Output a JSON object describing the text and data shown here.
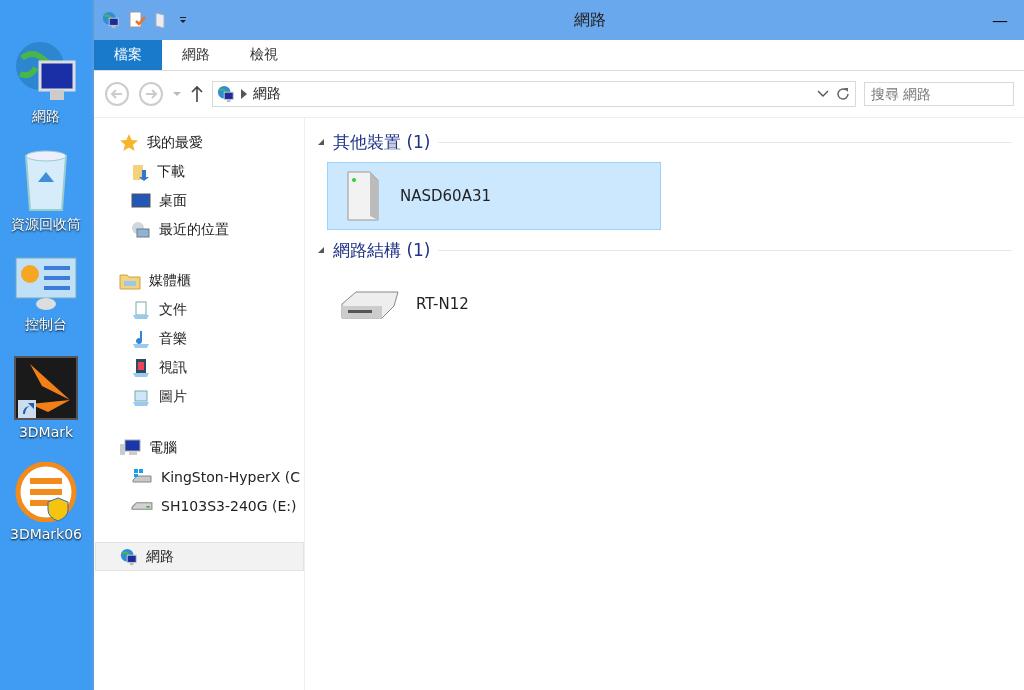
{
  "desktop_icons": [
    {
      "label": "網路",
      "kind": "network"
    },
    {
      "label": "資源回收筒",
      "kind": "recycle"
    },
    {
      "label": "控制台",
      "kind": "control"
    },
    {
      "label": "3DMark",
      "kind": "mark"
    },
    {
      "label": "3DMark06",
      "kind": "mark06"
    }
  ],
  "window": {
    "title": "網路",
    "minimize": "—"
  },
  "ribbon_tabs": [
    {
      "label": "檔案",
      "selected": true
    },
    {
      "label": "網路",
      "selected": false
    },
    {
      "label": "檢視",
      "selected": false
    }
  ],
  "address": {
    "path": "網路",
    "search_placeholder": "搜尋 網路"
  },
  "nav": [
    {
      "label": "我的最愛",
      "kind": "star",
      "selected": false,
      "children": [
        {
          "label": "下載",
          "kind": "download",
          "selected": false
        },
        {
          "label": "桌面",
          "kind": "desktop",
          "selected": false
        },
        {
          "label": "最近的位置",
          "kind": "recent",
          "selected": false
        }
      ]
    },
    {
      "label": "媒體櫃",
      "kind": "library",
      "selected": false,
      "children": [
        {
          "label": "文件",
          "kind": "doc",
          "selected": false
        },
        {
          "label": "音樂",
          "kind": "music",
          "selected": false
        },
        {
          "label": "視訊",
          "kind": "video",
          "selected": false
        },
        {
          "label": "圖片",
          "kind": "picture",
          "selected": false
        }
      ]
    },
    {
      "label": "電腦",
      "kind": "computer",
      "selected": false,
      "children": [
        {
          "label": "KingSton-HyperX (C",
          "kind": "windrive",
          "selected": false
        },
        {
          "label": "SH103S3-240G (E:)",
          "kind": "drive",
          "selected": false
        }
      ]
    },
    {
      "label": "網路",
      "kind": "network",
      "selected": true
    }
  ],
  "groups": [
    {
      "title": "其他裝置 (1)",
      "items": [
        {
          "label": "NASD60A31",
          "kind": "nas",
          "selected": true
        }
      ]
    },
    {
      "title": "網路結構 (1)",
      "items": [
        {
          "label": "RT-N12",
          "kind": "router",
          "selected": false
        }
      ]
    }
  ]
}
